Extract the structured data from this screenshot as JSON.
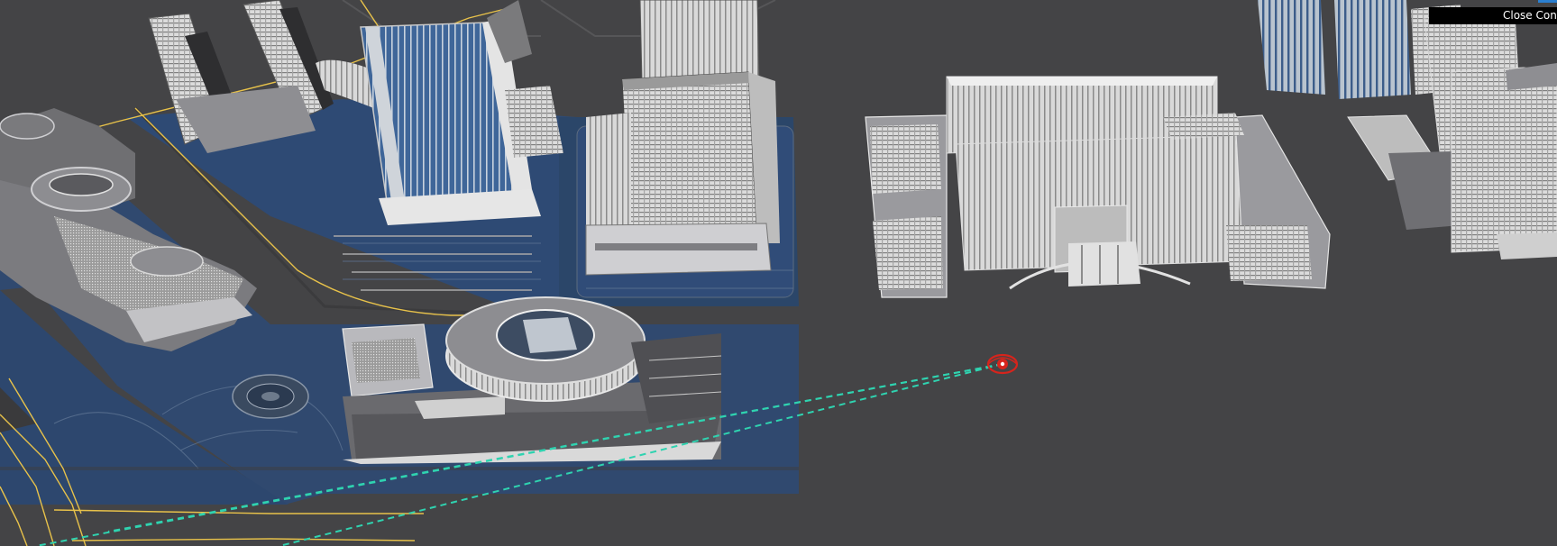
{
  "viewport": {
    "background": "#444446",
    "tooltip_text": "Close Con"
  },
  "scene": {
    "camera_marker_color": "#d6241c",
    "camera_sightline_color": "#2fd3b0",
    "spline_color": "#e8c24a",
    "ground_plaza_color": "#2f4a72",
    "building_glass_color": "#3d6496",
    "building_light_color": "#d8d8d8",
    "icons": [
      "eye-icon"
    ]
  }
}
